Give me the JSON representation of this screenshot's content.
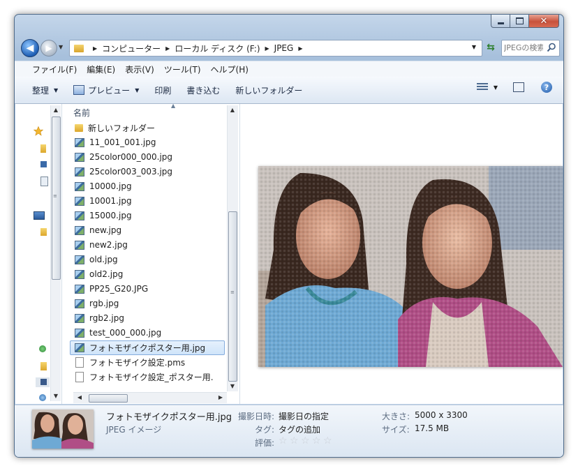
{
  "address": {
    "crumbs": [
      "コンピューター",
      "ローカル ディスク (F:)",
      "JPEG"
    ]
  },
  "search": {
    "placeholder": "JPEGの検索"
  },
  "menu": [
    "ファイル(F)",
    "編集(E)",
    "表示(V)",
    "ツール(T)",
    "ヘルプ(H)"
  ],
  "toolbar": {
    "organize": "整理",
    "preview": "プレビュー",
    "print": "印刷",
    "burn": "書き込む",
    "new_folder": "新しいフォルダー"
  },
  "file_list": {
    "column_name": "名前",
    "items": [
      {
        "name": "新しいフォルダー",
        "type": "folder"
      },
      {
        "name": "11_001_001.jpg",
        "type": "jpg"
      },
      {
        "name": "25color000_000.jpg",
        "type": "jpg"
      },
      {
        "name": "25color003_003.jpg",
        "type": "jpg"
      },
      {
        "name": "10000.jpg",
        "type": "jpg"
      },
      {
        "name": "10001.jpg",
        "type": "jpg"
      },
      {
        "name": "15000.jpg",
        "type": "jpg"
      },
      {
        "name": "new.jpg",
        "type": "jpg"
      },
      {
        "name": "new2.jpg",
        "type": "jpg"
      },
      {
        "name": "old.jpg",
        "type": "jpg"
      },
      {
        "name": "old2.jpg",
        "type": "jpg"
      },
      {
        "name": "PP25_G20.JPG",
        "type": "jpg"
      },
      {
        "name": "rgb.jpg",
        "type": "jpg"
      },
      {
        "name": "rgb2.jpg",
        "type": "jpg"
      },
      {
        "name": "test_000_000.jpg",
        "type": "jpg"
      },
      {
        "name": "フォトモザイクポスター用.jpg",
        "type": "jpg",
        "selected": true
      },
      {
        "name": "フォトモザイク設定.pms",
        "type": "doc"
      },
      {
        "name": "フォトモザイク設定_ポスター用.",
        "type": "doc"
      }
    ]
  },
  "details": {
    "filename": "フォトモザイクポスター用.jpg",
    "filetype": "JPEG イメージ",
    "date_taken_label": "撮影日時:",
    "date_taken_value": "撮影日の指定",
    "tags_label": "タグ:",
    "tags_value": "タグの追加",
    "rating_label": "評価:",
    "rating": 0,
    "dimensions_label": "大きさ:",
    "dimensions_value": "5000 x 3300",
    "size_label": "サイズ:",
    "size_value": "17.5 MB"
  },
  "colors": {
    "selection_bg": "#cfe4fa",
    "selection_border": "#84acdd",
    "frame": "#b9cde3"
  }
}
